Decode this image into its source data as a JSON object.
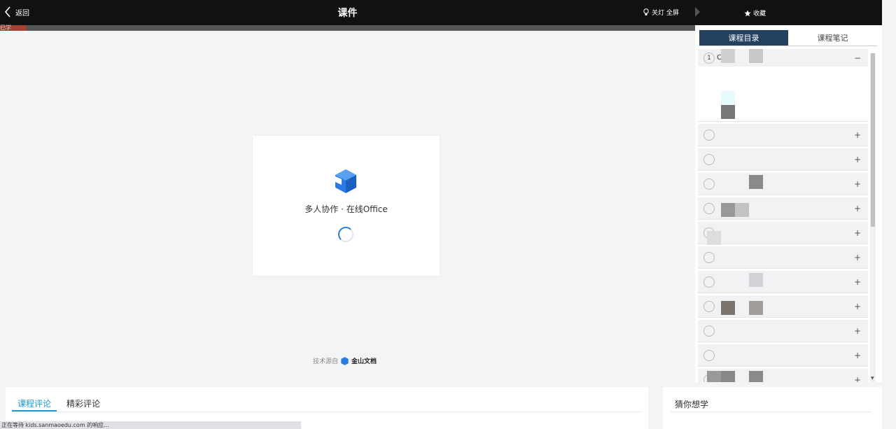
{
  "header": {
    "back_label": "返回",
    "title": "课件",
    "lamp_label": "关灯 全屏",
    "favorite_label": "收藏"
  },
  "notice_label": "已学",
  "viewer": {
    "slogan": "多人协作 · 在线Office",
    "tech_prefix": "技术源自",
    "tech_brand": "金山文档"
  },
  "sidebar": {
    "tabs": [
      {
        "label": "课程目录",
        "active": true
      },
      {
        "label": "课程笔记",
        "active": false
      }
    ],
    "chapters": [
      {
        "num": "1",
        "label": "C",
        "toggle": "−"
      },
      {
        "num": "",
        "label": "",
        "toggle": "+"
      },
      {
        "num": "",
        "label": "",
        "toggle": "+"
      },
      {
        "num": "",
        "label": "",
        "toggle": "+"
      },
      {
        "num": "",
        "label": "",
        "toggle": "+"
      },
      {
        "num": "",
        "label": "",
        "toggle": "+"
      },
      {
        "num": "",
        "label": "",
        "toggle": "+"
      },
      {
        "num": "",
        "label": "",
        "toggle": "+"
      },
      {
        "num": "",
        "label": "",
        "toggle": "+"
      },
      {
        "num": "",
        "label": "",
        "toggle": "+"
      },
      {
        "num": "",
        "label": "",
        "toggle": "+"
      },
      {
        "num": "",
        "label": "",
        "toggle": "+"
      }
    ]
  },
  "comments": {
    "tab_course": "课程评论",
    "tab_featured": "精彩评论"
  },
  "recommend": {
    "title": "猜你想学"
  },
  "statusbar": {
    "text": "正在等待 kids.sanmaoedu.com 的响应..."
  },
  "colors": {
    "accent_tab": "#23405f",
    "comment_accent": "#1a9ad6",
    "logo_blue": "#2b7be4"
  }
}
